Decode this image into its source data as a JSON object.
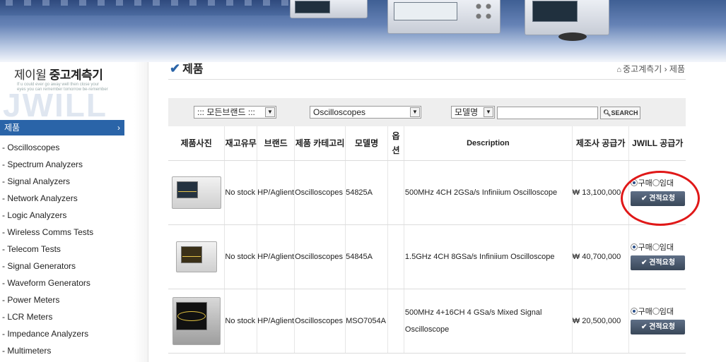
{
  "brand": {
    "name_regular": "제이윌 ",
    "name_bold": "중고계측기",
    "tagline": "If u could ever go away well then close your eyes you can remember tomorrow be-remember",
    "logo_text": "JWILL"
  },
  "sidebar": {
    "category_title": "제품",
    "category_arrow": "›",
    "items": [
      "- Oscilloscopes",
      "- Spectrum Analyzers",
      "- Signal Analyzers",
      "- Network Analyzers",
      "- Logic Analyzers",
      "- Wireless Comms Tests",
      "- Telecom Tests",
      "- Signal Generators",
      "- Waveform Generators",
      "- Power Meters",
      "- LCR Meters",
      "- Impedance Analyzers",
      "- Multimeters"
    ]
  },
  "page": {
    "title": "제품",
    "breadcrumb": [
      "중고계측기",
      "제품"
    ]
  },
  "filter": {
    "brand_select": "::: 모든브랜드 :::",
    "category_select": "Oscilloscopes",
    "field_select": "모델명",
    "search_value": "",
    "search_button": "SEARCH"
  },
  "table": {
    "headers": [
      "제품사진",
      "재고유무",
      "브랜드",
      "제품 카테고리",
      "모델명",
      "옵션",
      "Description",
      "제조사 공급가",
      "JWILL 공급가"
    ],
    "buy_label": "구매",
    "rent_label": "임대",
    "quote_button": "견적요청",
    "rows": [
      {
        "stock": "No stock",
        "brand": "HP/Aglient",
        "category": "Oscilloscopes",
        "model": "54825A",
        "option": "",
        "description": "500MHz 4CH 2GSa/s Infiniium Oscilloscope",
        "list_price": "₩ 13,100,000"
      },
      {
        "stock": "No stock",
        "brand": "HP/Aglient",
        "category": "Oscilloscopes",
        "model": "54845A",
        "option": "",
        "description": "1.5GHz 4CH 8GSa/s Infiniium Oscilloscope",
        "list_price": "₩ 40,700,000"
      },
      {
        "stock": "No stock",
        "brand": "HP/Aglient",
        "category": "Oscilloscopes",
        "model": "MSO7054A",
        "option": "",
        "description": "500MHz 4+16CH 4 GSa/s Mixed Signal Oscilloscope",
        "list_price": "₩ 20,500,000"
      }
    ]
  },
  "colors": {
    "accent": "#2a64a8",
    "highlight_circle": "#e01818",
    "filter_bg": "#eeeeee"
  }
}
